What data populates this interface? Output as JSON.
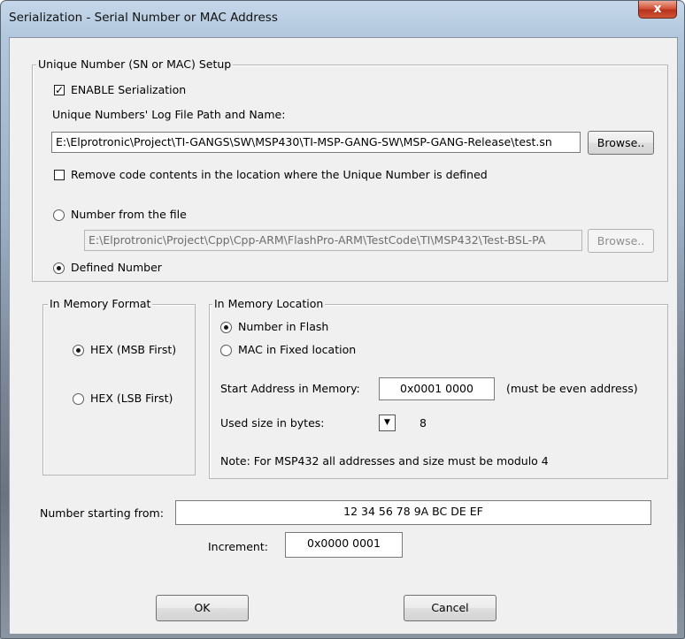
{
  "window": {
    "title": "Serialization - Serial Number or MAC Address",
    "close_glyph": "x"
  },
  "setup": {
    "group_title": "Unique Number (SN or MAC) Setup",
    "enable_label": "ENABLE Serialization",
    "enable_checked": true,
    "logfile_label": "Unique Numbers' Log File Path and Name:",
    "logfile_path": "E:\\Elprotronic\\Project\\TI-GANGS\\SW\\MSP430\\TI-MSP-GANG-SW\\MSP-GANG-Release\\test.sn",
    "browse_label": "Browse..",
    "remove_label": "Remove code contents in the location where the Unique Number is defined",
    "remove_checked": false,
    "from_file_label": "Number from the file",
    "from_file_path": "E:\\Elprotronic\\Project\\Cpp\\Cpp-ARM\\FlashPro-ARM\\TestCode\\TI\\MSP432\\Test-BSL-PA",
    "browse2_label": "Browse..",
    "defined_label": "Defined Number"
  },
  "format": {
    "group_title": "In Memory Format",
    "msb_label": "HEX (MSB First)",
    "lsb_label": "HEX (LSB First)"
  },
  "location": {
    "group_title": "In Memory Location",
    "flash_label": "Number in Flash",
    "mac_label": "MAC in Fixed location",
    "start_label": "Start Address in Memory:",
    "start_value": "0x0001 0000",
    "start_note": "(must be even address)",
    "size_label": "Used size in bytes:",
    "size_value": "8",
    "note": "Note: For MSP432 all addresses and size must be modulo 4"
  },
  "number": {
    "start_label": "Number starting from:",
    "start_value": "12 34 56 78 9A BC DE EF",
    "increment_label": "Increment:",
    "increment_value": "0x0000 0001"
  },
  "buttons": {
    "ok": "OK",
    "cancel": "Cancel"
  }
}
